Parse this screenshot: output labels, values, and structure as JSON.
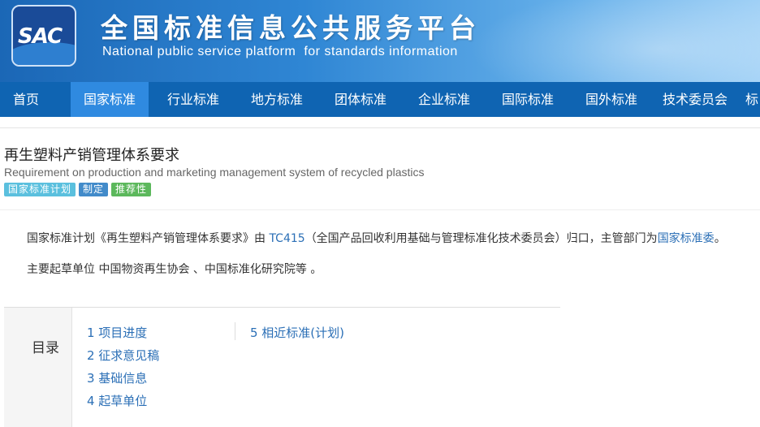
{
  "header": {
    "logo_text": "SAC",
    "title": "全国标准信息公共服务平台",
    "subtitle_part1": "National public service platform",
    "subtitle_part2": "for standards information"
  },
  "nav": {
    "items": [
      {
        "label": "首页"
      },
      {
        "label": "国家标准"
      },
      {
        "label": "行业标准"
      },
      {
        "label": "地方标准"
      },
      {
        "label": "团体标准"
      },
      {
        "label": "企业标准"
      },
      {
        "label": "国际标准"
      },
      {
        "label": "国外标准"
      },
      {
        "label": "技术委员会"
      },
      {
        "label": "标"
      }
    ],
    "active_index": 1
  },
  "standard": {
    "title": "再生塑料产销管理体系要求",
    "title_en": "Requirement on production and marketing management system of recycled plastics",
    "badges": [
      {
        "label": "国家标准计划",
        "color": "#5bc0de"
      },
      {
        "label": "制定",
        "color": "#428bca"
      },
      {
        "label": "推荐性",
        "color": "#5cb85c"
      }
    ]
  },
  "description": {
    "p1_pre": "国家标准计划《再生塑料产销管理体系要求》由 ",
    "tc_link": "TC415",
    "p1_mid": "（全国产品回收利用基础与管理标准化技术委员会）归口，主管部门为",
    "dept_link": "国家标准委",
    "p1_end": "。",
    "p2": "主要起草单位 中国物资再生协会 、中国标准化研究院等 。"
  },
  "toc": {
    "label": "目录",
    "items": [
      {
        "label": "1  项目进度"
      },
      {
        "label": "2  征求意见稿"
      },
      {
        "label": "3  基础信息"
      },
      {
        "label": "4  起草单位"
      },
      {
        "label": "5  相近标准(计划)"
      }
    ]
  }
}
